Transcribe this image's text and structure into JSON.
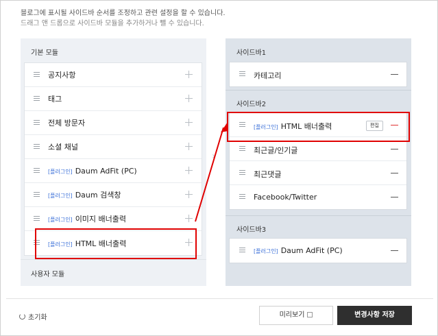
{
  "description": {
    "line1": "블로그에 표시될 사이드바 순서를 조정하고 관련 설정을 할 수 있습니다.",
    "line2": "드래그 앤 드롭으로 사이드바 모듈을 추가하거나 뺄 수 있습니다."
  },
  "left_panel": {
    "title": "기본 모듈",
    "modules": [
      {
        "tag": "",
        "label": "공지사항"
      },
      {
        "tag": "",
        "label": "태그"
      },
      {
        "tag": "",
        "label": "전체 방문자"
      },
      {
        "tag": "",
        "label": "소셜 채널"
      },
      {
        "tag": "[플러그인]",
        "label": "Daum AdFit (PC)"
      },
      {
        "tag": "[플러그인]",
        "label": "Daum 검색창"
      },
      {
        "tag": "[플러그인]",
        "label": "이미지 배너출력"
      },
      {
        "tag": "[플러그인]",
        "label": "HTML 배너출력"
      }
    ],
    "user_modules_title": "사용자 모듈"
  },
  "right_panel": {
    "sidebar1": {
      "title": "사이드바1",
      "items": [
        {
          "tag": "",
          "label": "카테고리"
        }
      ]
    },
    "sidebar2": {
      "title": "사이드바2",
      "items": [
        {
          "tag": "[플러그인]",
          "label": "HTML 배너출력",
          "edit": "편집"
        },
        {
          "tag": "",
          "label": "최근글/인기글"
        },
        {
          "tag": "",
          "label": "최근댓글"
        },
        {
          "tag": "",
          "label": "Facebook/Twitter"
        }
      ]
    },
    "sidebar3": {
      "title": "사이드바3",
      "items": [
        {
          "tag": "[플러그인]",
          "label": "Daum AdFit (PC)"
        }
      ]
    }
  },
  "footer": {
    "reset_label": "초기화",
    "preview_label": "미리보기",
    "save_label": "변경사항 저장"
  },
  "colors": {
    "plugin_tag": "#3a6fd8",
    "highlight": "#e00000",
    "save_button_bg": "#2f2f2f"
  }
}
